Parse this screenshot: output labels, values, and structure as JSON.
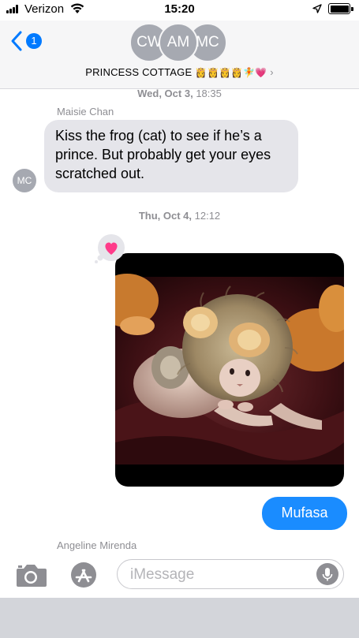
{
  "status_bar": {
    "carrier": "Verizon",
    "time": "15:20"
  },
  "header": {
    "back_badge": "1",
    "avatars": [
      "CW",
      "AM",
      "MC"
    ],
    "group_name": "PRINCESS COTTAGE",
    "group_emojis": "👸👸👸👸🧚💗",
    "chevron": "›"
  },
  "conversation": {
    "timestamp_1_day": "Wed, Oct 3,",
    "timestamp_1_time": "18:35",
    "message_1": {
      "sender": "Maisie Chan",
      "avatar": "MC",
      "text": "Kiss the frog (cat) to see if he’s a prince. But probably get your eyes scratched out."
    },
    "timestamp_2_day": "Thu, Oct 4,",
    "timestamp_2_time": "12:12",
    "photo_message": {
      "reaction": "heart"
    },
    "message_2": {
      "text": "Mufasa"
    },
    "typing_sender": "Angeline Mirenda"
  },
  "input_bar": {
    "placeholder": "iMessage"
  },
  "colors": {
    "accent": "#007aff",
    "outgoing_bubble": "#1a8cff",
    "incoming_bubble": "#e5e5ea",
    "reaction_heart": "#ff3b8a"
  },
  "icons": [
    "wifi-icon",
    "location-icon",
    "battery-icon",
    "back-chevron-icon",
    "camera-icon",
    "app-store-icon",
    "microphone-icon",
    "heart-icon"
  ]
}
